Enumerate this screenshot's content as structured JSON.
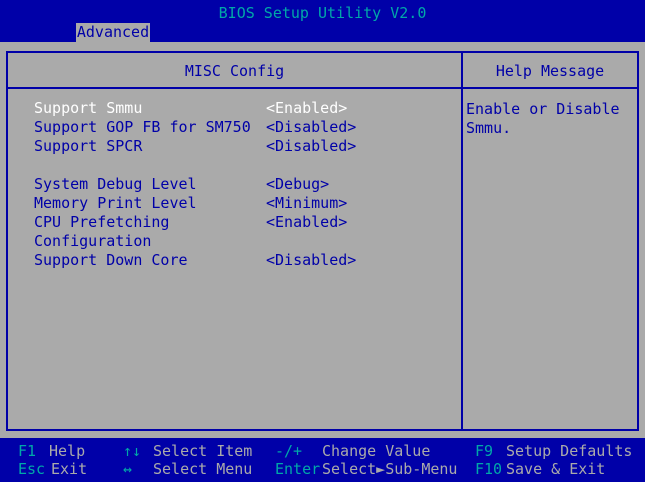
{
  "app": {
    "title": "BIOS Setup Utility V2.0",
    "active_tab": "Advanced"
  },
  "main": {
    "section_title": "MISC Config",
    "items": [
      {
        "label": "Support Smmu",
        "value": "<Enabled>"
      },
      {
        "label": "Support GOP FB for SM750",
        "value": "<Disabled>"
      },
      {
        "label": "Support SPCR",
        "value": "<Disabled>"
      },
      {
        "label": "System Debug Level",
        "value": "<Debug>"
      },
      {
        "label": "Memory Print Level",
        "value": "<Minimum>"
      },
      {
        "label": "CPU Prefetching",
        "value": "<Enabled>"
      },
      {
        "label": "Configuration",
        "value": ""
      },
      {
        "label": "Support Down Core",
        "value": "<Disabled>"
      }
    ]
  },
  "help": {
    "title": "Help Message",
    "text": "Enable or Disable\nSmmu."
  },
  "footer": {
    "keys": [
      {
        "key": "F1",
        "desc": "Help"
      },
      {
        "key": "Esc",
        "desc": "Exit"
      },
      {
        "key": "↑↓",
        "desc": "Select Item"
      },
      {
        "key": "↔",
        "desc": "Select Menu"
      },
      {
        "key": "-/+",
        "desc": "Change Value"
      },
      {
        "key": "Enter",
        "desc": "Select►Sub-Menu"
      },
      {
        "key": "F9",
        "desc": "Setup Defaults"
      },
      {
        "key": "F10",
        "desc": "Save & Exit"
      }
    ]
  },
  "colors": {
    "background": "#0000a8",
    "panel": "#aaaaaa",
    "title_text": "#00a8a8",
    "selected_text": "#ffffff"
  }
}
